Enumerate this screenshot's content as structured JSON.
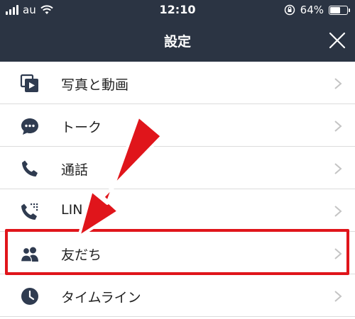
{
  "status_bar": {
    "carrier": "au",
    "time": "12:10",
    "battery": "64%",
    "battery_level": 0.64
  },
  "header": {
    "title": "設定",
    "close_icon": "close-icon"
  },
  "items": [
    {
      "label": "写真と動画",
      "icon": "photo-video-icon"
    },
    {
      "label": "トーク",
      "icon": "chat-bubble-icon"
    },
    {
      "label": "通話",
      "icon": "phone-icon"
    },
    {
      "label": "LIN",
      "icon": "line-out-icon"
    },
    {
      "label": "友だち",
      "icon": "friends-icon"
    },
    {
      "label": "タイムライン",
      "icon": "clock-icon"
    }
  ],
  "colors": {
    "header_bg": "#2b3443",
    "icon": "#2f3b50",
    "highlight": "#e0151b"
  }
}
